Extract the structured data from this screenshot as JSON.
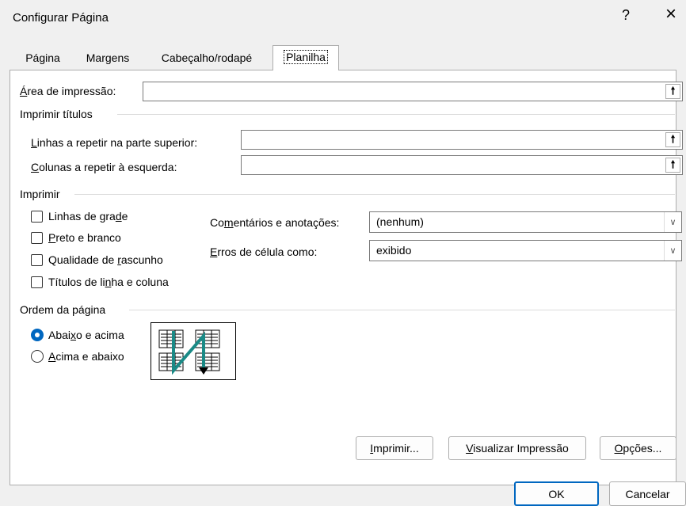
{
  "window": {
    "title": "Configurar Página",
    "help_icon": "?",
    "close_icon": "×"
  },
  "tabs": [
    {
      "label": "Página"
    },
    {
      "label": "Margens"
    },
    {
      "label": "Cabeçalho/rodapé"
    },
    {
      "label": "Planilha",
      "active": true
    }
  ],
  "print_area": {
    "label_first": "Á",
    "label_rest": "rea de impressão:",
    "value": ""
  },
  "print_titles": {
    "group": "Imprimir títulos",
    "rows_first": "L",
    "rows_rest": "inhas a repetir na parte superior:",
    "cols_first": "C",
    "cols_rest": "olunas a repetir à esquerda:"
  },
  "print": {
    "group": "Imprimir",
    "gridlines_a": "Linhas de gra",
    "gridlines_u": "d",
    "gridlines_b": "e",
    "bw_u": "P",
    "bw_b": "reto e branco",
    "draft_a": "Qualidade de ",
    "draft_u": "r",
    "draft_b": "ascunho",
    "headings_a": "Títulos de li",
    "headings_u": "n",
    "headings_b": "ha e coluna",
    "comments_a": "Co",
    "comments_u": "m",
    "comments_b": "entários e anotações:",
    "comments_value": "(nenhum)",
    "errors_u": "E",
    "errors_b": "rros de célula como:",
    "errors_value": "exibido"
  },
  "page_order": {
    "group": "Ordem da página",
    "down_a": "Abai",
    "down_u": "x",
    "down_b": "o e acima",
    "over_u": "A",
    "over_b": "cima e abaixo",
    "selected": "down_then_over"
  },
  "buttons": {
    "print_u": "I",
    "print_b": "mprimir...",
    "preview_u": "V",
    "preview_b": "isualizar Impressão",
    "options_u": "O",
    "options_b": "pções...",
    "ok": "OK",
    "cancel": "Cancelar"
  },
  "colors": {
    "accent": "#0067c0",
    "arrow": "#1a8a86"
  }
}
